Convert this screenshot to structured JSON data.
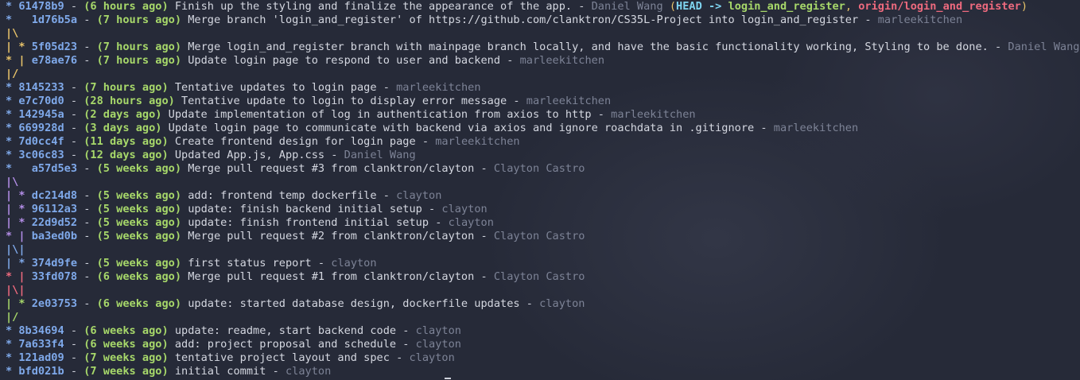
{
  "colors": {
    "background": "#262a38",
    "hash": "#7fa9ea",
    "date": "#a7d86a",
    "message": "#d4d7e0",
    "author": "#7d8396",
    "graph_blue": "#7fa9ea",
    "graph_yellow": "#e9c46a",
    "graph_purple": "#b48ee8",
    "graph_red": "#ee6a7e",
    "graph_green": "#a7d86a",
    "ref_head": "#7fd4f0",
    "ref_local": "#a7d86a",
    "ref_remote": "#ee6a7e"
  },
  "log": [
    {
      "graph": "* ",
      "graph_color": "#7fa9ea",
      "hash": "61478b9",
      "date": "(6 hours ago)",
      "message": "Finish up the styling and finalize the appearance of the app.",
      "author": "Daniel Wang",
      "refs": {
        "open": "(",
        "head": "HEAD -> ",
        "local": "login_and_register",
        "sep": ", ",
        "remote": "origin/login_and_register",
        "close": ")"
      }
    },
    {
      "graph": "*   ",
      "graph_color": "#7fa9ea",
      "hash": "1d76b5a",
      "date": "(7 hours ago)",
      "message": "Merge branch 'login_and_register' of https://github.com/clanktron/CS35L-Project into login_and_register",
      "author": "marleekitchen"
    },
    {
      "graph": "|\\",
      "graph_color": "#e9c46a"
    },
    {
      "graph": "| * ",
      "graph_color": "#e9c46a",
      "hash": "5f05d23",
      "date": "(7 hours ago)",
      "message": "Merge login_and_register branch with mainpage branch locally, and have the basic functionality working, Styling to be done.",
      "author": "Daniel Wang"
    },
    {
      "graph": "* | ",
      "graph_color": "#e9c46a",
      "hash": "e78ae76",
      "date": "(7 hours ago)",
      "message": "Update login page to respond to user and backend",
      "author": "marleekitchen"
    },
    {
      "graph": "|/",
      "graph_color": "#e9c46a"
    },
    {
      "graph": "* ",
      "graph_color": "#7fa9ea",
      "hash": "8145233",
      "date": "(7 hours ago)",
      "message": "Tentative updates to login page",
      "author": "marleekitchen"
    },
    {
      "graph": "* ",
      "graph_color": "#7fa9ea",
      "hash": "e7c70d0",
      "date": "(28 hours ago)",
      "message": "Tentative update to login to display error message",
      "author": "marleekitchen"
    },
    {
      "graph": "* ",
      "graph_color": "#7fa9ea",
      "hash": "142945a",
      "date": "(2 days ago)",
      "message": "Update implementation of log in authentication from axios to http",
      "author": "marleekitchen"
    },
    {
      "graph": "* ",
      "graph_color": "#7fa9ea",
      "hash": "669928d",
      "date": "(3 days ago)",
      "message": "Update login page to communicate with backend via axios and ignore roachdata in .gitignore",
      "author": "marleekitchen"
    },
    {
      "graph": "* ",
      "graph_color": "#7fa9ea",
      "hash": "7d0cc4f",
      "date": "(11 days ago)",
      "message": "Create frontend design for login page",
      "author": "marleekitchen"
    },
    {
      "graph": "* ",
      "graph_color": "#7fa9ea",
      "hash": "3c06c83",
      "date": "(12 days ago)",
      "message": "Updated App.js, App.css",
      "author": "Daniel Wang"
    },
    {
      "graph": "*   ",
      "graph_color": "#7fa9ea",
      "hash": "a57d5e3",
      "date": "(5 weeks ago)",
      "message": "Merge pull request #3 from clanktron/clayton",
      "author": "Clayton Castro"
    },
    {
      "graph": "|\\",
      "graph_color": "#b48ee8"
    },
    {
      "graph": "| * ",
      "graph_color": "#b48ee8",
      "hash": "dc214d8",
      "date": "(5 weeks ago)",
      "message": "add: frontend temp dockerfile",
      "author": "clayton"
    },
    {
      "graph": "| * ",
      "graph_color": "#b48ee8",
      "hash": "96112a3",
      "date": "(5 weeks ago)",
      "message": "update: finish backend initial setup",
      "author": "clayton"
    },
    {
      "graph": "| * ",
      "graph_color": "#b48ee8",
      "hash": "22d9d52",
      "date": "(5 weeks ago)",
      "message": "update: finish frontend initial setup",
      "author": "clayton"
    },
    {
      "graph": "* | ",
      "graph_color": "#b48ee8",
      "hash": "ba3ed0b",
      "date": "(5 weeks ago)",
      "message": "Merge pull request #2 from clanktron/clayton",
      "author": "Clayton Castro"
    },
    {
      "graph": "|\\|",
      "graph_color": "#7fa9ea"
    },
    {
      "graph": "| * ",
      "graph_color": "#7fa9ea",
      "hash": "374d9fe",
      "date": "(5 weeks ago)",
      "message": "first status report",
      "author": "clayton"
    },
    {
      "graph": "* | ",
      "graph_color": "#ee6a7e",
      "hash": "33fd078",
      "date": "(6 weeks ago)",
      "message": "Merge pull request #1 from clanktron/clayton",
      "author": "Clayton Castro"
    },
    {
      "graph": "|\\|",
      "graph_color": "#ee6a7e"
    },
    {
      "graph": "| * ",
      "graph_color": "#a7d86a",
      "hash": "2e03753",
      "date": "(6 weeks ago)",
      "message": "update: started database design, dockerfile updates",
      "author": "clayton"
    },
    {
      "graph": "|/",
      "graph_color": "#a7d86a"
    },
    {
      "graph": "* ",
      "graph_color": "#7fa9ea",
      "hash": "8b34694",
      "date": "(6 weeks ago)",
      "message": "update: readme, start backend code",
      "author": "clayton"
    },
    {
      "graph": "* ",
      "graph_color": "#7fa9ea",
      "hash": "7a633f4",
      "date": "(6 weeks ago)",
      "message": "add: project proposal and schedule",
      "author": "clayton"
    },
    {
      "graph": "* ",
      "graph_color": "#7fa9ea",
      "hash": "121ad09",
      "date": "(7 weeks ago)",
      "message": "tentative project layout and spec",
      "author": "clayton"
    },
    {
      "graph": "* ",
      "graph_color": "#7fa9ea",
      "hash": "bfd021b",
      "date": "(7 weeks ago)",
      "message": "initial commit",
      "author": "clayton"
    }
  ]
}
